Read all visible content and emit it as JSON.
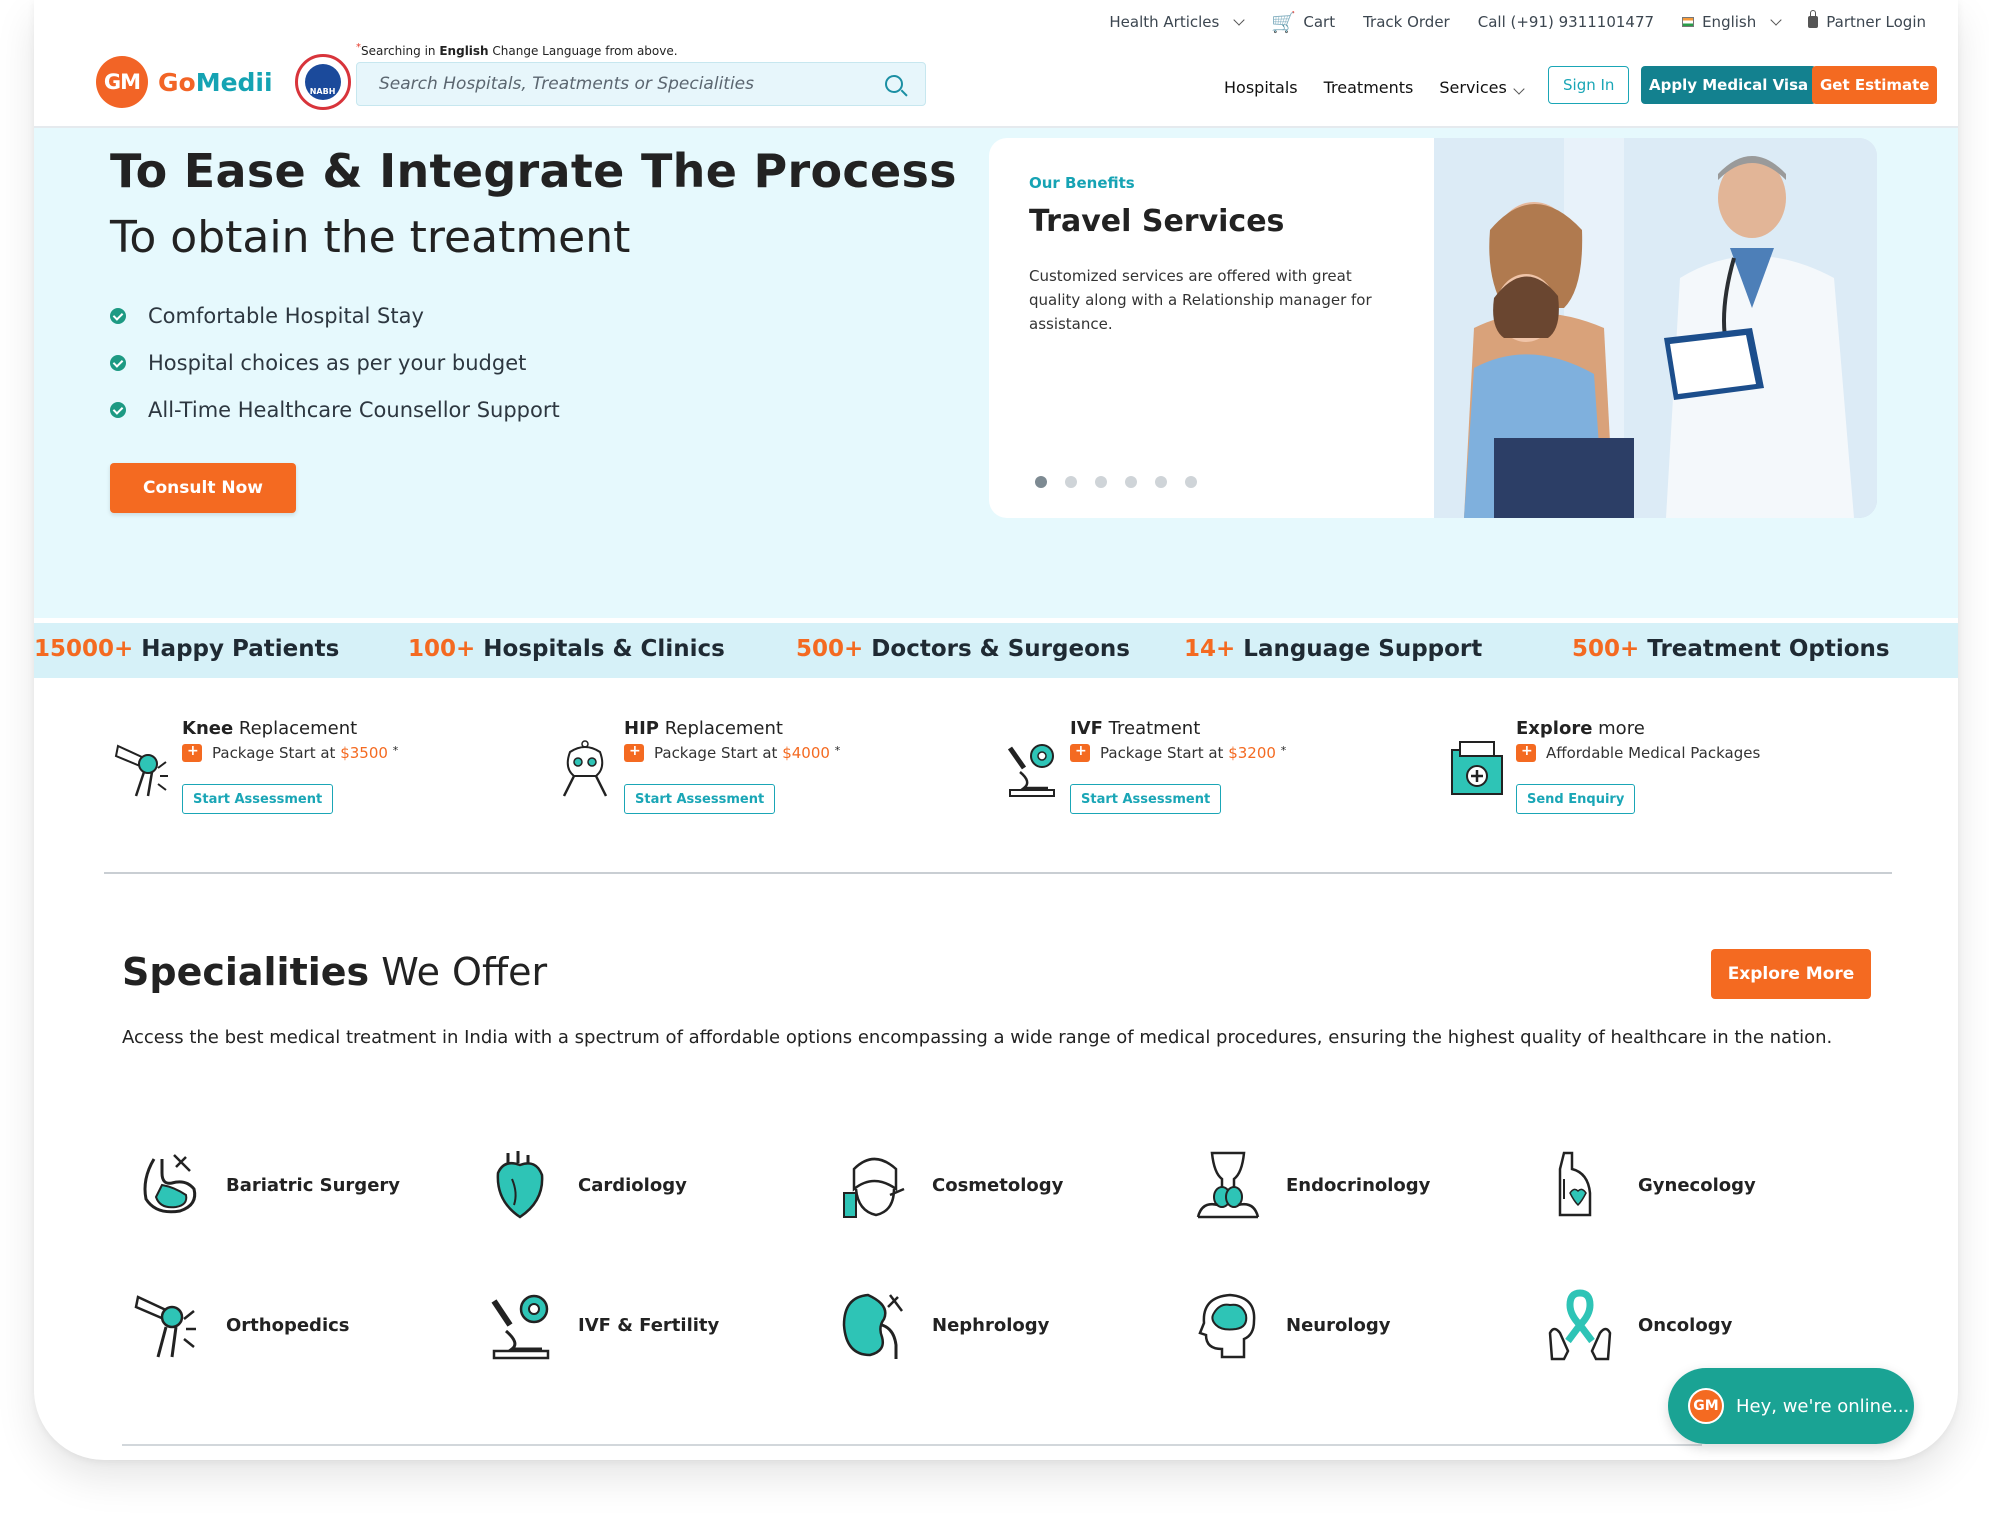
{
  "utility": {
    "health_articles": "Health Articles",
    "cart": "Cart",
    "track_order": "Track Order",
    "call": "Call (+91) 9311101477",
    "language": "English",
    "partner_login": "Partner Login"
  },
  "brand": {
    "gm": "GM",
    "name_a": "Go",
    "name_b": "Medii",
    "nabh": "NABH"
  },
  "search": {
    "note_prefix": "Searching in ",
    "note_lang": "English",
    "note_suffix": " Change Language from above.",
    "placeholder": "Search Hospitals, Treatments or Specialities"
  },
  "nav": {
    "hospitals": "Hospitals",
    "treatments": "Treatments",
    "services": "Services",
    "sign_in": "Sign In",
    "apply_visa": "Apply Medical Visa",
    "get_estimate": "Get Estimate"
  },
  "hero": {
    "title": "To Ease & Integrate The Process",
    "subtitle": "To obtain the treatment",
    "points": [
      "Comfortable Hospital Stay",
      "Hospital choices as per your budget",
      "All-Time Healthcare Counsellor Support"
    ],
    "cta": "Consult Now"
  },
  "benefit_card": {
    "kicker": "Our Benefits",
    "title": "Travel Services",
    "desc": "Customized services are offered with great quality along with a Relationship manager for assistance.",
    "slide_count": 6,
    "active_slide": 1
  },
  "stats": [
    {
      "num": "15000+",
      "label": " Happy Patients"
    },
    {
      "num": "100+",
      "label": " Hospitals & Clinics"
    },
    {
      "num": "500+",
      "label": " Doctors & Surgeons"
    },
    {
      "num": "14+",
      "label": " Language Support"
    },
    {
      "num": "500+",
      "label": " Treatment Options"
    }
  ],
  "packages": [
    {
      "bold": "Knee",
      "rest": " Replacement",
      "line": "Package Start at ",
      "price": "$3500",
      "ast": "*",
      "button": "Start Assessment",
      "icon": "knee-icon"
    },
    {
      "bold": "HIP",
      "rest": " Replacement",
      "line": "Package Start at ",
      "price": "$4000",
      "ast": "*",
      "button": "Start Assessment",
      "icon": "hip-icon"
    },
    {
      "bold": "IVF",
      "rest": " Treatment",
      "line": "Package Start at ",
      "price": "$3200",
      "ast": "*",
      "button": "Start Assessment",
      "icon": "microscope-icon"
    },
    {
      "bold": "Explore",
      "rest": " more",
      "line": "Affordable Medical Packages",
      "price": "",
      "ast": "",
      "button": "Send Enquiry",
      "icon": "medical-folder-icon"
    }
  ],
  "specialities": {
    "title_bold": "Specialities",
    "title_rest": " We Offer",
    "explore": "Explore More",
    "desc": "Access the best medical treatment in India with a spectrum of affordable options encompassing a wide range of medical procedures, ensuring the highest quality of healthcare in the nation.",
    "items": [
      "Bariatric Surgery",
      "Cardiology",
      "Cosmetology",
      "Endocrinology",
      "Gynecology",
      "Orthopedics",
      "IVF & Fertility",
      "Nephrology",
      "Neurology",
      "Oncology"
    ]
  },
  "chat": {
    "gm": "GM",
    "text": "Hey, we're online..."
  },
  "colors": {
    "orange": "#f46a21",
    "teal": "#1aa6b6",
    "dark_teal": "#13818f",
    "hero_bg": "#e6f9fd",
    "stats_bg": "#d6f1f8"
  }
}
